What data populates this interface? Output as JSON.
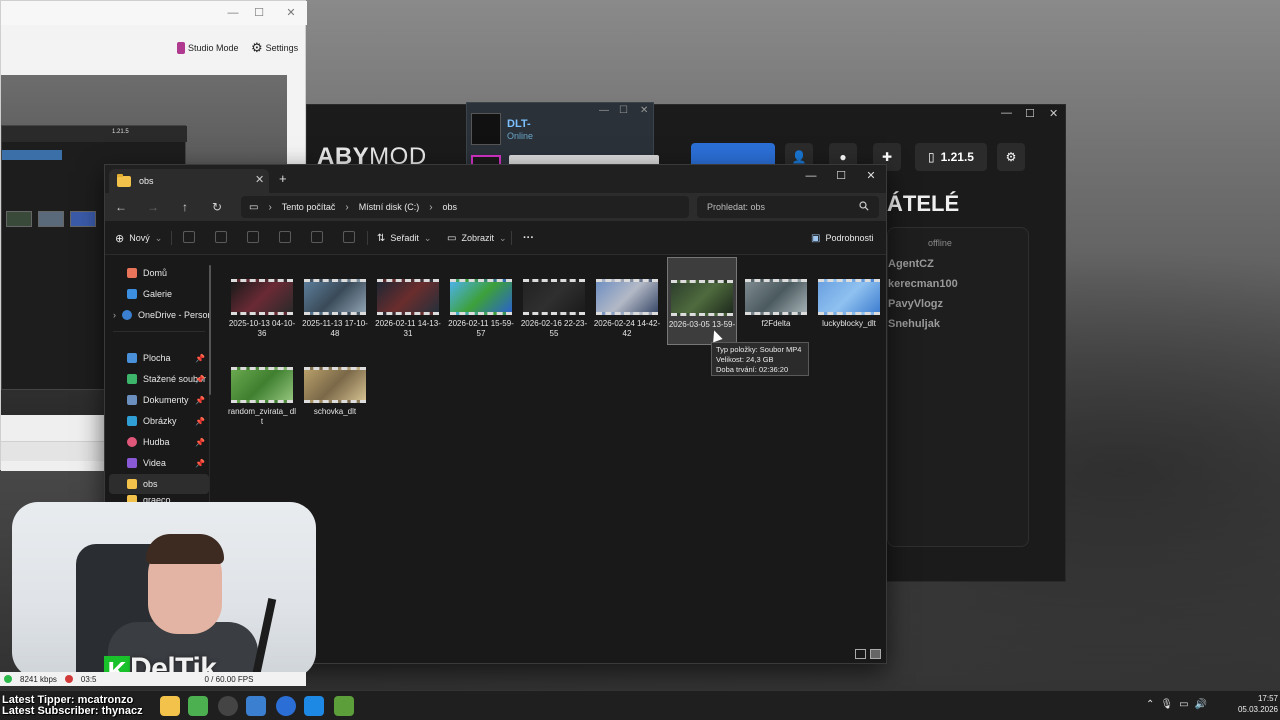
{
  "obs": {
    "studio_mode_label": "Studio Mode",
    "settings_label": "Settings",
    "nested_version": "1.21.5"
  },
  "launcher": {
    "logo_bold": "ABY",
    "logo_thin": "MOD",
    "version_label": "1.21.5",
    "friends_title": "ÁTELÉ",
    "offline_label": "offline",
    "friends": [
      "AgentCZ",
      "kerecman100",
      "PavyVlogz",
      "Snehuljak"
    ]
  },
  "chat": {
    "name": "DLT-",
    "status": "Online"
  },
  "explorer": {
    "tab_title": "obs",
    "breadcrumb": [
      "Tento počítač",
      "Místní disk (C:)",
      "obs"
    ],
    "search_placeholder": "Prohledat: obs",
    "toolbar": {
      "new_label": "Nový",
      "sort_label": "Seřadit",
      "view_label": "Zobrazit",
      "more_label": "···",
      "details_label": "Podrobnosti"
    },
    "sidebar": [
      {
        "label": "Domů",
        "color": "#e8745a",
        "pinned": false
      },
      {
        "label": "Galerie",
        "color": "#3b8ee0",
        "pinned": false
      },
      {
        "label": "OneDrive - Persor",
        "color": "#3a7fd0",
        "pinned": false
      },
      {
        "label": "Plocha",
        "color": "#4a90d9",
        "pinned": true
      },
      {
        "label": "Stažené soubor",
        "color": "#3db56b",
        "pinned": true
      },
      {
        "label": "Dokumenty",
        "color": "#6b8fbf",
        "pinned": true
      },
      {
        "label": "Obrázky",
        "color": "#2f9fd6",
        "pinned": true
      },
      {
        "label": "Hudba",
        "color": "#e0577a",
        "pinned": true
      },
      {
        "label": "Videa",
        "color": "#8a5ad6",
        "pinned": true
      },
      {
        "label": "obs",
        "color": "#f3c24a",
        "pinned": false
      },
      {
        "label": "graeco",
        "color": "#f3c24a",
        "pinned": false
      }
    ],
    "files": [
      {
        "name": "2025-10-13 04-10-36",
        "colors": [
          "#1a1a1a",
          "#6b2a35",
          "#2a2a2a"
        ]
      },
      {
        "name": "2025-11-13 17-10-48",
        "colors": [
          "#5c7d9a",
          "#3a4a58",
          "#8fa3b3"
        ]
      },
      {
        "name": "2026-02-11 14-13-31",
        "colors": [
          "#1f2733",
          "#6b2d2d",
          "#25303b"
        ]
      },
      {
        "name": "2026-02-11 15-59-57",
        "colors": [
          "#4db2e8",
          "#3da03a",
          "#2a63c9"
        ]
      },
      {
        "name": "2026-02-16 22-23-55",
        "colors": [
          "#232323",
          "#2f2f2f",
          "#1b1b1b"
        ]
      },
      {
        "name": "2026-02-24 14-42-42",
        "colors": [
          "#6f8fc2",
          "#b3b9c6",
          "#3a4a6a"
        ]
      },
      {
        "name": "2026-03-05 13-59-",
        "colors": [
          "#2d3f2c",
          "#4f6b3e",
          "#1e2a1c"
        ]
      },
      {
        "name": "f2Fdelta",
        "colors": [
          "#7d8a8f",
          "#4b5a5f",
          "#a4b0b4"
        ]
      },
      {
        "name": "luckyblocky_dlt",
        "colors": [
          "#6aa0e0",
          "#8fc1f0",
          "#3f7ed0"
        ]
      },
      {
        "name": "random_zvirata_ dlt",
        "colors": [
          "#6aa84f",
          "#3f7f2f",
          "#93c47d"
        ]
      },
      {
        "name": "schovka_dlt",
        "colors": [
          "#b89f6a",
          "#7a6848",
          "#d4c090"
        ]
      }
    ],
    "tooltip": {
      "type": "Typ položky: Soubor MP4",
      "size": "Velikost: 24,3 GB",
      "duration": "Doba trvání: 02:36:20"
    }
  },
  "stream": {
    "brand_text": "DelTik",
    "kbps": "8241 kbps",
    "time": "03:5",
    "fps": "0 / 60.00 FPS"
  },
  "taskbar": {
    "latest_tipper": "Latest Tipper: mcatronzo",
    "latest_subscriber": "Latest Subscriber: thynacz",
    "clock_time": "17:57",
    "clock_date": "05.03.2026"
  }
}
